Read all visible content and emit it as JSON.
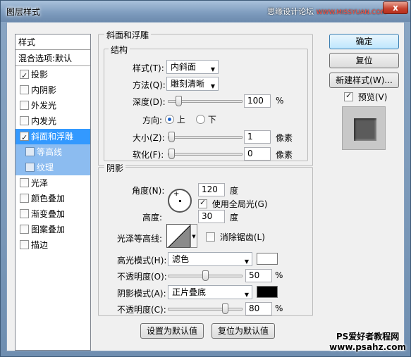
{
  "window": {
    "title": "图层样式",
    "close_label": "x"
  },
  "watermark": {
    "top_text": "思缘设计论坛",
    "top_url": "WWW.MISSYUAN.COM",
    "bottom_line1": "PS爱好者教程网",
    "bottom_line2": "www.psahz.com"
  },
  "style_list": {
    "header": "样式",
    "blend_options": "混合选项:默认",
    "items": [
      {
        "label": "投影",
        "checked": true
      },
      {
        "label": "内阴影",
        "checked": false
      },
      {
        "label": "外发光",
        "checked": false
      },
      {
        "label": "内发光",
        "checked": false
      },
      {
        "label": "斜面和浮雕",
        "checked": true,
        "selected": true
      },
      {
        "label": "等高线",
        "checked": false,
        "sub": true
      },
      {
        "label": "纹理",
        "checked": false,
        "sub": true
      },
      {
        "label": "光泽",
        "checked": false
      },
      {
        "label": "颜色叠加",
        "checked": false
      },
      {
        "label": "渐变叠加",
        "checked": false
      },
      {
        "label": "图案叠加",
        "checked": false
      },
      {
        "label": "描边",
        "checked": false
      }
    ]
  },
  "bevel": {
    "group_title": "斜面和浮雕",
    "structure_title": "结构",
    "style_label": "样式(T):",
    "style_value": "内斜面",
    "technique_label": "方法(Q):",
    "technique_value": "雕刻清晰",
    "depth_label": "深度(D):",
    "depth_value": "100",
    "depth_unit": "%",
    "depth_level": 0.1,
    "direction_label": "方向:",
    "direction_up": "上",
    "direction_down": "下",
    "direction_selected": "up",
    "size_label": "大小(Z):",
    "size_value": "1",
    "size_unit": "像素",
    "size_level": 0.0,
    "soften_label": "软化(F):",
    "soften_value": "0",
    "soften_unit": "像素",
    "soften_level": 0.0
  },
  "shading": {
    "group_title": "阴影",
    "angle_label": "角度(N):",
    "angle_value": "120",
    "angle_unit": "度",
    "global_light_label": "使用全局光(G)",
    "global_light_checked": true,
    "altitude_label": "高度:",
    "altitude_value": "30",
    "altitude_unit": "度",
    "gloss_contour_label": "光泽等高线:",
    "antialias_label": "消除锯齿(L)",
    "antialias_checked": false,
    "highlight_mode_label": "高光模式(H):",
    "highlight_mode_value": "滤色",
    "highlight_color": "#ffffff",
    "highlight_opacity_label": "不透明度(O):",
    "highlight_opacity_value": "50",
    "highlight_opacity_unit": "%",
    "highlight_opacity_level": 0.5,
    "shadow_mode_label": "阴影模式(A):",
    "shadow_mode_value": "正片叠底",
    "shadow_color": "#000000",
    "shadow_opacity_label": "不透明度(C):",
    "shadow_opacity_value": "80",
    "shadow_opacity_unit": "%",
    "shadow_opacity_level": 0.8
  },
  "bottom_buttons": {
    "make_default": "设置为默认值",
    "reset_default": "复位为默认值"
  },
  "right_panel": {
    "ok": "确定",
    "reset": "复位",
    "new_style": "新建样式(W)...",
    "preview_label": "预览(V)",
    "preview_checked": true
  }
}
